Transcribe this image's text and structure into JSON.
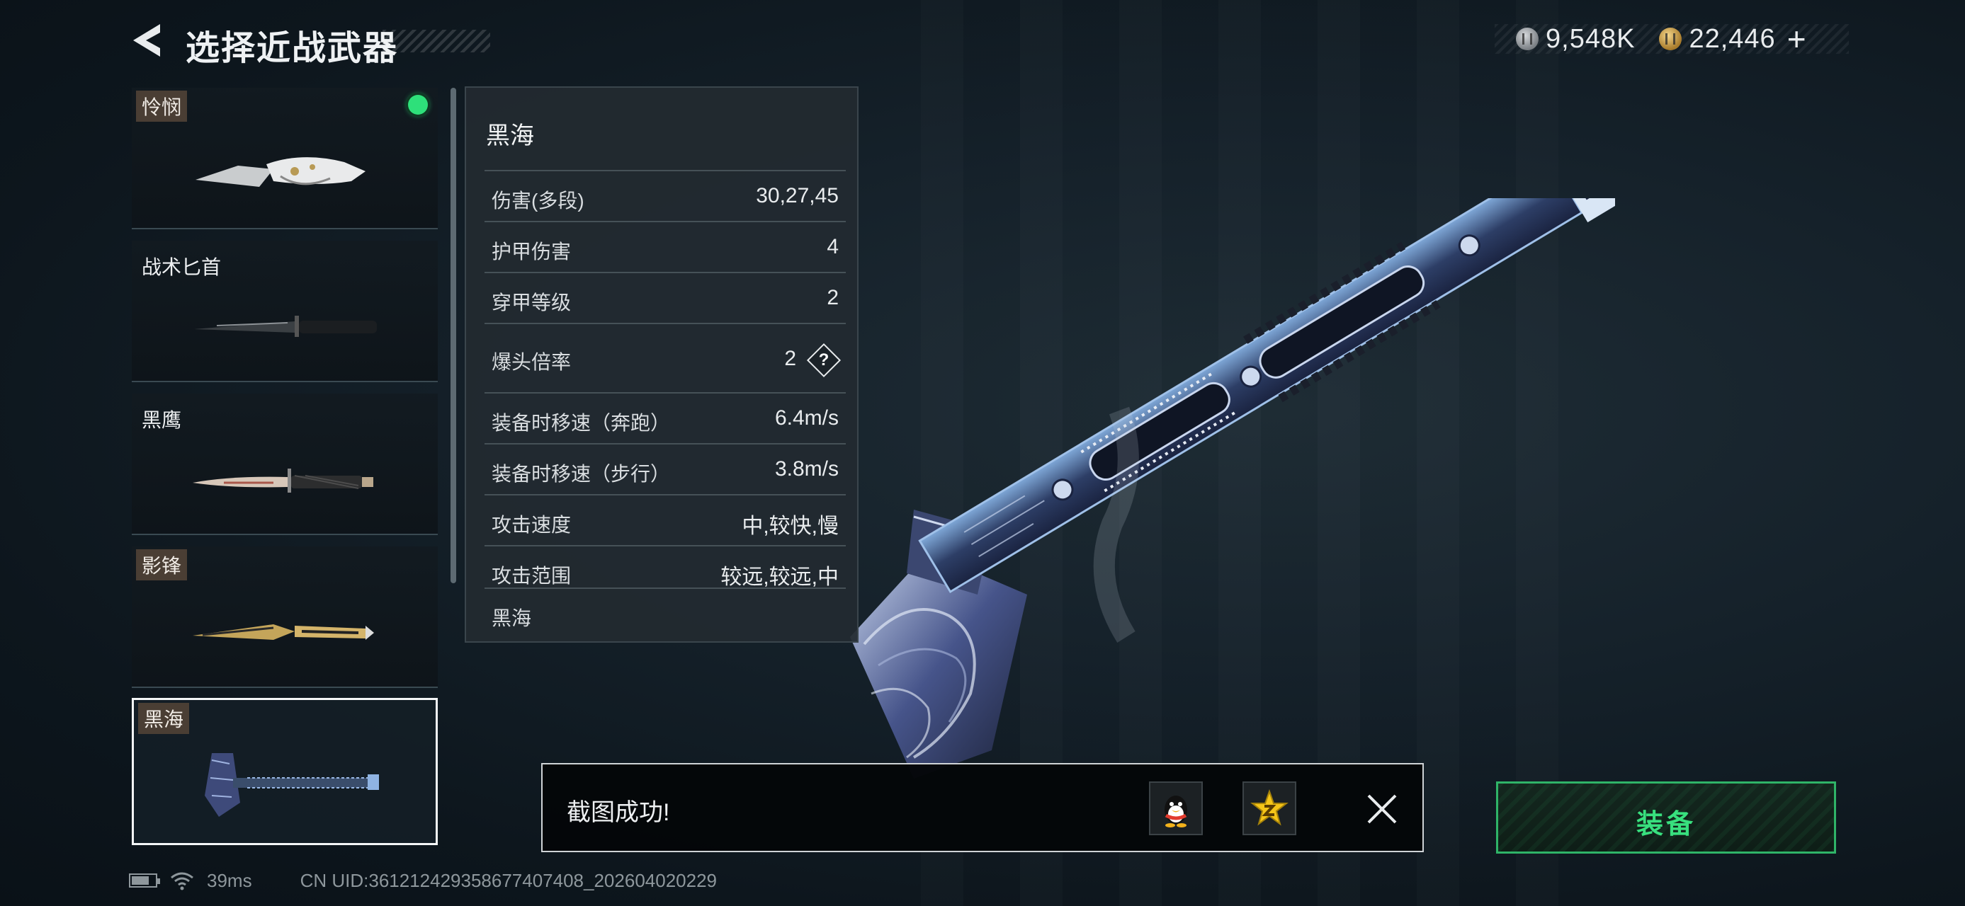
{
  "header": {
    "title": "选择近战武器"
  },
  "currency": {
    "silver": "9,548K",
    "gold": "22,446"
  },
  "weapons": [
    {
      "name": "怜悯",
      "tagged": true,
      "equipped": true
    },
    {
      "name": "战术匕首",
      "tagged": false
    },
    {
      "name": "黑鹰",
      "tagged": false
    },
    {
      "name": "影锋",
      "tagged": true
    },
    {
      "name": "黑海",
      "tagged": true,
      "selected": true
    }
  ],
  "stats": {
    "name": "黑海",
    "rows": [
      {
        "label": "伤害(多段)",
        "value": "30,27,45"
      },
      {
        "label": "护甲伤害",
        "value": "4"
      },
      {
        "label": "穿甲等级",
        "value": "2"
      },
      {
        "label": "爆头倍率",
        "value": "2"
      },
      {
        "label": "装备时移速（奔跑）",
        "value": "6.4m/s"
      },
      {
        "label": "装备时移速（步行）",
        "value": "3.8m/s"
      },
      {
        "label": "攻击速度",
        "value": "中,较快,慢"
      },
      {
        "label": "攻击范围",
        "value": "较远,较远,中"
      }
    ],
    "footer": "黑海",
    "help_glyph": "?"
  },
  "toast": {
    "text": "截图成功!"
  },
  "equip_button": {
    "label": "装备"
  },
  "status": {
    "ping": "39ms",
    "uid": "CN UID:361212429358677407408_202604020229"
  },
  "colors": {
    "accent_green": "#2fb468",
    "equipped_dot": "#2ee07a",
    "tag_bg": "#4a3e34",
    "background": "#15212a"
  },
  "icons": [
    "back-arrow-icon",
    "silver-coin-icon",
    "gold-coin-icon",
    "plus-icon",
    "help-icon",
    "qq-icon",
    "star-badge-icon",
    "close-icon",
    "battery-icon",
    "wifi-icon"
  ]
}
